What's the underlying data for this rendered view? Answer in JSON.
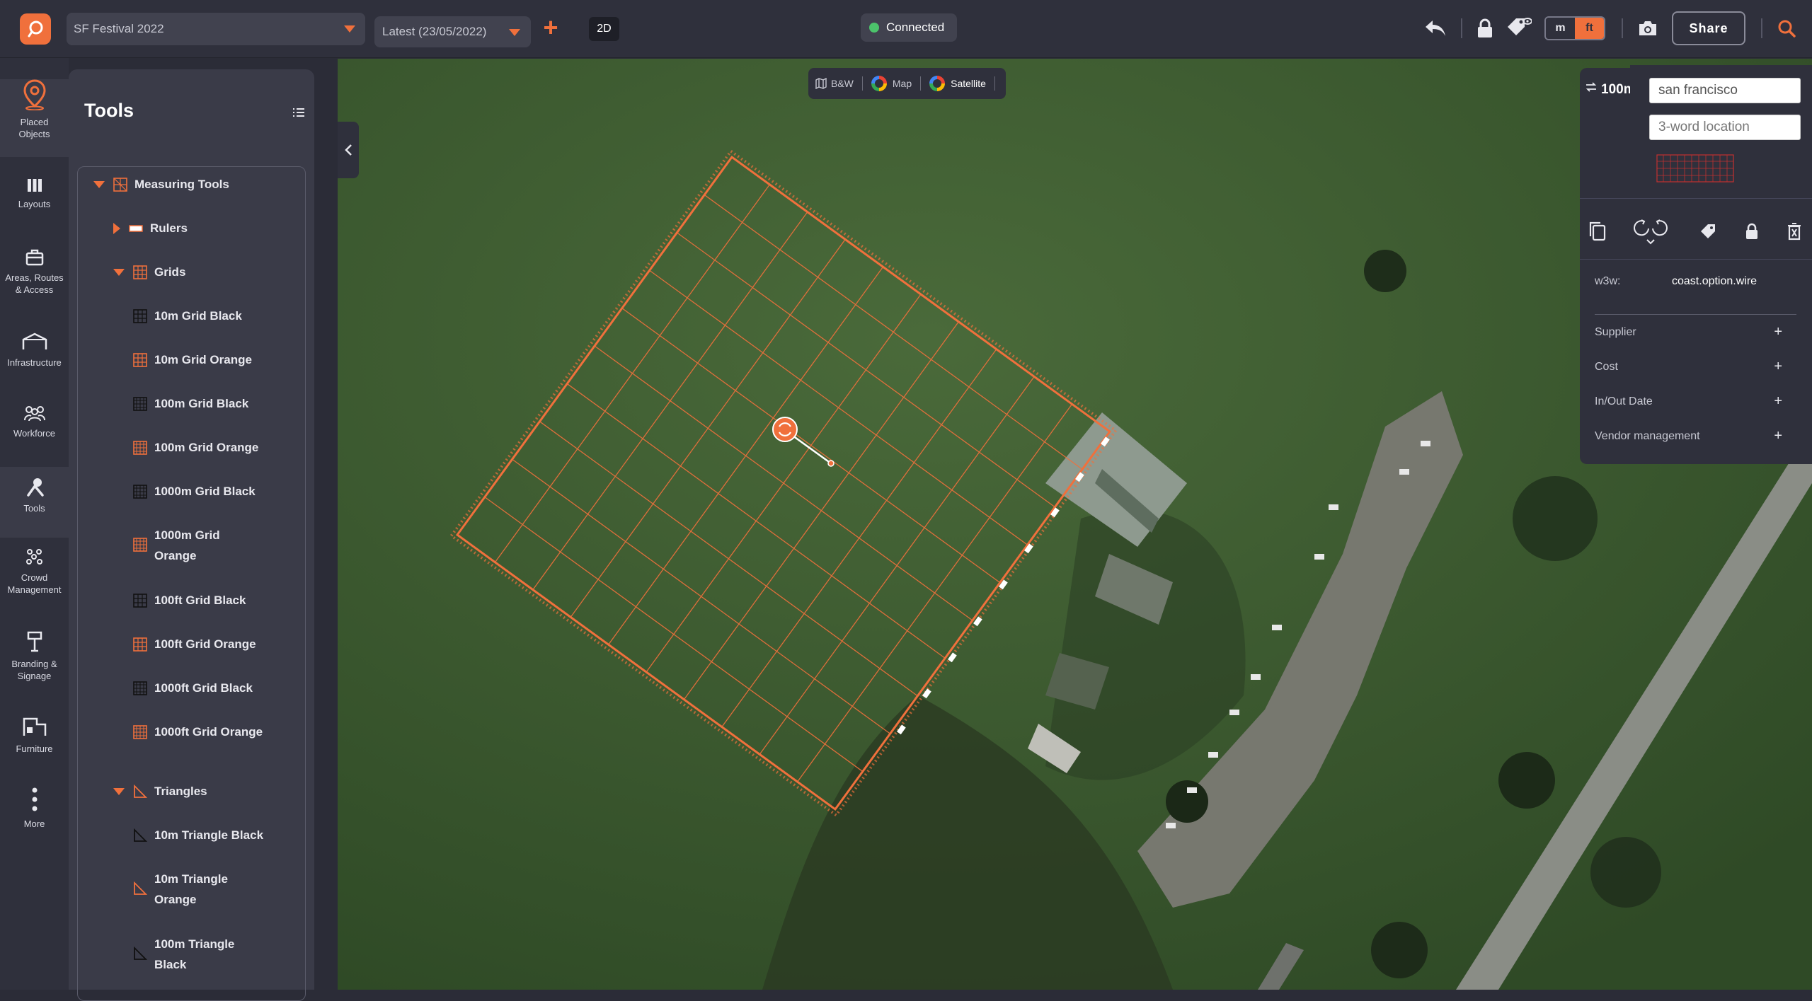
{
  "header": {
    "project": "SF Festival 2022",
    "version": "Latest (23/05/2022)",
    "view_mode": "2D",
    "status": "Connected",
    "unit_m": "m",
    "unit_ft": "ft",
    "share": "Share"
  },
  "rail": {
    "items": [
      {
        "label": "Placed Objects",
        "icon": "map-pin-icon"
      },
      {
        "label": "Layouts",
        "icon": "columns-icon"
      },
      {
        "label": "Areas, Routes & Access",
        "icon": "route-icon"
      },
      {
        "label": "Infrastructure",
        "icon": "tent-icon"
      },
      {
        "label": "Workforce",
        "icon": "people-icon"
      },
      {
        "label": "Tools",
        "icon": "tools-icon"
      },
      {
        "label": "Crowd Management",
        "icon": "crowd-icon"
      },
      {
        "label": "Branding & Signage",
        "icon": "signage-icon"
      },
      {
        "label": "Furniture",
        "icon": "furniture-icon"
      },
      {
        "label": "More",
        "icon": "more-icon"
      }
    ]
  },
  "tools": {
    "title": "Tools",
    "tree": {
      "root": "Measuring Tools",
      "rulers": "Rulers",
      "grids": "Grids",
      "grid_items": [
        "10m Grid Black",
        "10m Grid Orange",
        "100m Grid Black",
        "100m Grid Orange",
        "1000m Grid Black",
        "1000m Grid Orange",
        "100ft Grid Black",
        "100ft Grid Orange",
        "1000ft Grid Black",
        "1000ft Grid Orange"
      ],
      "triangles": "Triangles",
      "triangle_items": [
        "10m Triangle Black",
        "10m Triangle Orange",
        "100m Triangle Black"
      ]
    }
  },
  "map": {
    "modes": [
      "B&W",
      "Map",
      "Satellite"
    ],
    "active_mode": "Satellite"
  },
  "props": {
    "name": "100m",
    "location_city": "san francisco",
    "location_w3w_placeholder": "3-word location",
    "w3w_label": "w3w:",
    "w3w_value": "coast.option.wire",
    "rows": [
      "Supplier",
      "Cost",
      "In/Out Date",
      "Vendor management"
    ]
  },
  "colors": {
    "accent": "#f0703c",
    "panel": "#2f303c",
    "panel_light": "#3a3b48",
    "connected": "#4cc36b"
  }
}
